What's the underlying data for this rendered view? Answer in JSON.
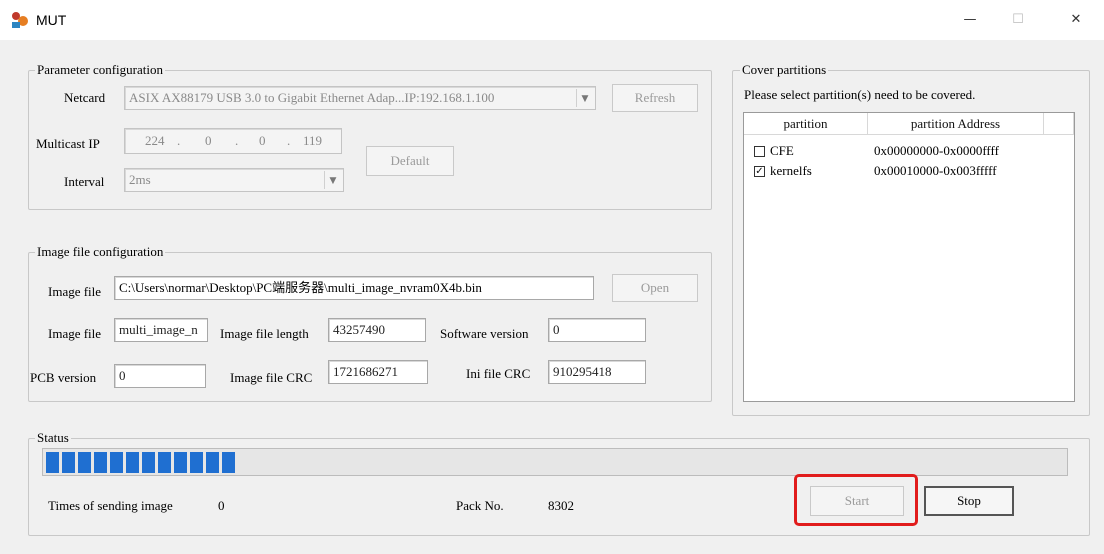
{
  "window": {
    "title": "MUT",
    "minimize": "—",
    "maximize": "☐",
    "close": "✕"
  },
  "param": {
    "legend": "Parameter configuration",
    "netcard_label": "Netcard",
    "netcard_value": "ASIX AX88179 USB 3.0 to Gigabit Ethernet Adap...IP:192.168.1.100",
    "refresh_label": "Refresh",
    "multicast_label": "Multicast IP",
    "ip_octets": [
      "224",
      "0",
      "0",
      "119"
    ],
    "default_label": "Default",
    "interval_label": "Interval",
    "interval_value": "2ms"
  },
  "cover": {
    "legend": "Cover partitions",
    "prompt": "Please select partition(s) need to be covered.",
    "col_partition": "partition",
    "col_address": "partition Address",
    "rows": [
      {
        "name": "CFE",
        "address": "0x00000000-0x0000ffff",
        "checked": false
      },
      {
        "name": "kernelfs",
        "address": "0x00010000-0x003fffff",
        "checked": true
      }
    ]
  },
  "image": {
    "legend": "Image file configuration",
    "file_label": "Image file",
    "file_path": "C:\\Users\\normar\\Desktop\\PC端服务器\\multi_image_nvram0X4b.bin",
    "open_label": "Open",
    "file2_label": "Image file",
    "file2_value": "multi_image_n",
    "length_label": "Image file length",
    "length_value": "43257490",
    "software_label": "Software version",
    "software_value": "0",
    "pcb_label": "PCB version",
    "pcb_value": "0",
    "crc_label": "Image file CRC",
    "crc_value": "1721686271",
    "ini_crc_label": "Ini file CRC",
    "ini_crc_value": "910295418"
  },
  "status": {
    "legend": "Status",
    "progress_segments": 12,
    "progress_percent": 19,
    "times_label": "Times of sending image",
    "times_value": "0",
    "pack_label": "Pack No.",
    "pack_value": "8302",
    "start_label": "Start",
    "stop_label": "Stop"
  },
  "colors": {
    "progress": "#1f6fd1",
    "highlight": "#e11c1c"
  }
}
